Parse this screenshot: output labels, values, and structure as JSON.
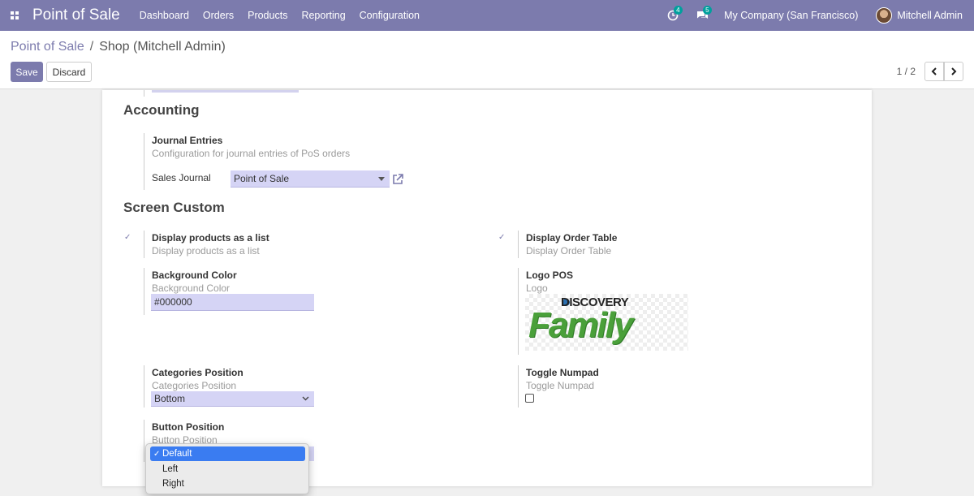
{
  "navbar": {
    "app_title": "Point of Sale",
    "menu": [
      "Dashboard",
      "Orders",
      "Products",
      "Reporting",
      "Configuration"
    ],
    "activity_count": "4",
    "messages_count": "5",
    "company": "My Company (San Francisco)",
    "user": "Mitchell Admin",
    "background_color": "#7c7bad"
  },
  "breadcrumb": {
    "parent": "Point of Sale",
    "separator": "/",
    "current": "Shop (Mitchell Admin)"
  },
  "actions": {
    "save": "Save",
    "discard": "Discard"
  },
  "pager": {
    "value": "1 / 2"
  },
  "accounting": {
    "title": "Accounting",
    "journal_entries_label": "Journal Entries",
    "journal_entries_desc": "Configuration for journal entries of PoS orders",
    "sales_journal_label": "Sales Journal",
    "sales_journal_value": "Point of Sale"
  },
  "screen_custom": {
    "title": "Screen Custom",
    "products_list_label": "Display products as a list",
    "products_list_desc": "Display products as a list",
    "order_table_label": "Display Order Table",
    "order_table_desc": "Display Order Table",
    "background_color_label": "Background Color",
    "background_color_desc": "Background Color",
    "background_color_value": "#000000",
    "logo_label": "Logo POS",
    "logo_desc": "Logo",
    "logo_text_top": "DISCOVERY",
    "logo_text_main": "Family",
    "categories_label": "Categories Position",
    "categories_desc": "Categories Position",
    "categories_value": "Bottom",
    "numpad_label": "Toggle Numpad",
    "numpad_desc": "Toggle Numpad",
    "button_position_label": "Button Position",
    "button_position_desc": "Button Position"
  },
  "button_position_dropdown": {
    "options": [
      "Default",
      "Left",
      "Right"
    ],
    "selected": "Default"
  }
}
